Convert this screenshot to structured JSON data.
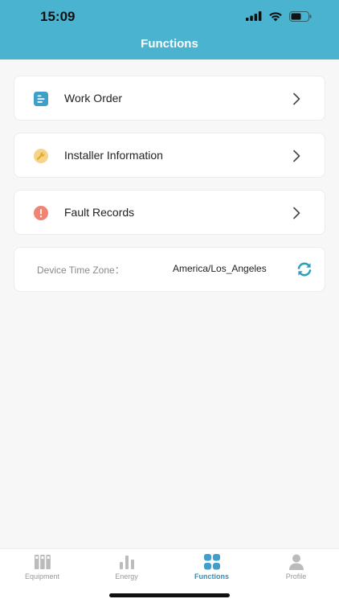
{
  "status_bar": {
    "time": "15:09"
  },
  "header": {
    "title": "Functions"
  },
  "menu": [
    {
      "label": "Work Order",
      "icon": "work-order-icon",
      "color": "#3f9fc9"
    },
    {
      "label": "Installer Information",
      "icon": "wrench-icon",
      "color": "#f6d48a"
    },
    {
      "label": "Fault Records",
      "icon": "exclamation-icon",
      "color": "#ef8474"
    }
  ],
  "timezone": {
    "label": "Device Time Zone：",
    "value": "America/Los_Angeles",
    "icon": "refresh-icon"
  },
  "tabs": [
    {
      "label": "Equipment",
      "icon": "equipment-icon",
      "active": false
    },
    {
      "label": "Energy",
      "icon": "bar-chart-icon",
      "active": false
    },
    {
      "label": "Functions",
      "icon": "grid-icon",
      "active": true
    },
    {
      "label": "Profile",
      "icon": "person-icon",
      "active": false
    }
  ],
  "colors": {
    "accent": "#4ab3cf",
    "active_tab": "#2f8fc0",
    "inactive": "#999999"
  }
}
